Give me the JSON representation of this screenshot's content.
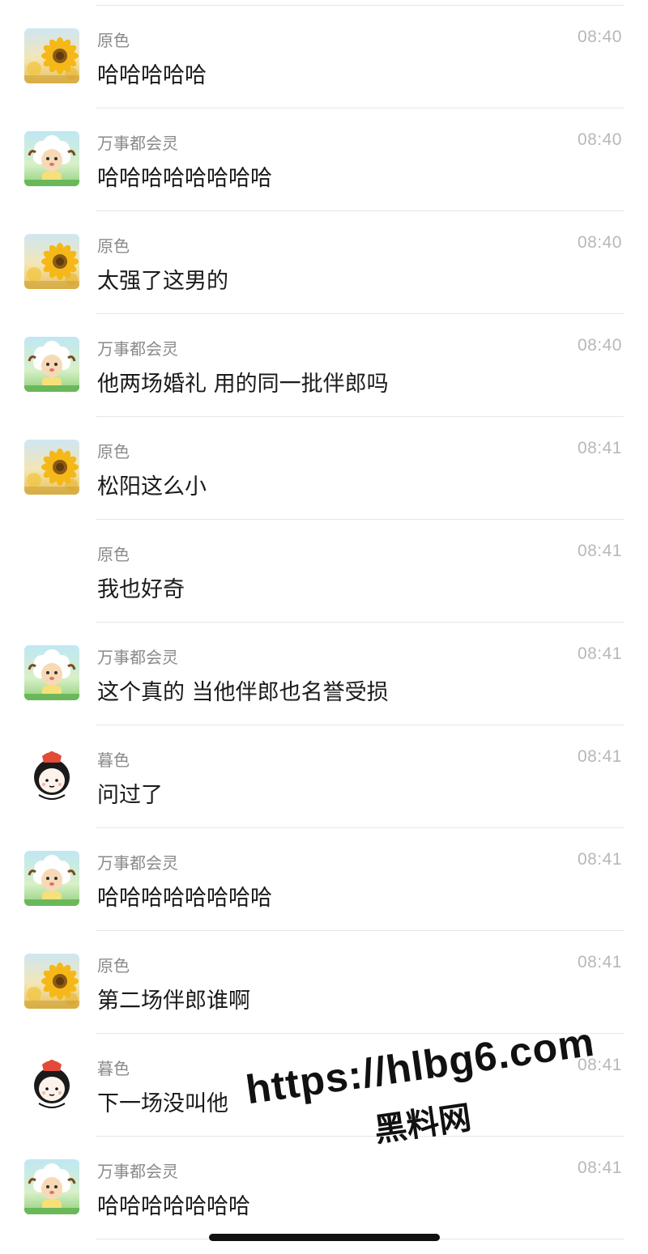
{
  "messages": [
    {
      "avatar": "sunflower-avatar",
      "sender": "原色",
      "time": "08:40",
      "text": "哈哈哈哈哈"
    },
    {
      "avatar": "sheep-avatar",
      "sender": "万事都会灵",
      "time": "08:40",
      "text": "哈哈哈哈哈哈哈哈"
    },
    {
      "avatar": "sunflower-avatar",
      "sender": "原色",
      "time": "08:40",
      "text": "太强了这男的"
    },
    {
      "avatar": "sheep-avatar",
      "sender": "万事都会灵",
      "time": "08:40",
      "text": "他两场婚礼 用的同一批伴郎吗"
    },
    {
      "avatar": "sunflower-avatar",
      "sender": "原色",
      "time": "08:41",
      "text": "松阳这么小"
    },
    {
      "avatar": "none",
      "sender": "原色",
      "time": "08:41",
      "text": "我也好奇"
    },
    {
      "avatar": "sheep-avatar",
      "sender": "万事都会灵",
      "time": "08:41",
      "text": "这个真的 当他伴郎也名誉受损"
    },
    {
      "avatar": "cartoon-girl-avatar",
      "sender": "暮色",
      "time": "08:41",
      "text": "问过了"
    },
    {
      "avatar": "sheep-avatar",
      "sender": "万事都会灵",
      "time": "08:41",
      "text": "哈哈哈哈哈哈哈哈"
    },
    {
      "avatar": "sunflower-avatar",
      "sender": "原色",
      "time": "08:41",
      "text": "第二场伴郎谁啊"
    },
    {
      "avatar": "cartoon-girl-avatar",
      "sender": "暮色",
      "time": "08:41",
      "text": "下一场没叫他"
    },
    {
      "avatar": "sheep-avatar",
      "sender": "万事都会灵",
      "time": "08:41",
      "text": "哈哈哈哈哈哈哈"
    }
  ],
  "watermark": {
    "url": "https://hlbg6.com",
    "name": "黑料网"
  },
  "colors": {
    "sender": "#8a8a8a",
    "time": "#b8b8b8",
    "text": "#1a1a1a",
    "separator": "#e6e6e6"
  }
}
